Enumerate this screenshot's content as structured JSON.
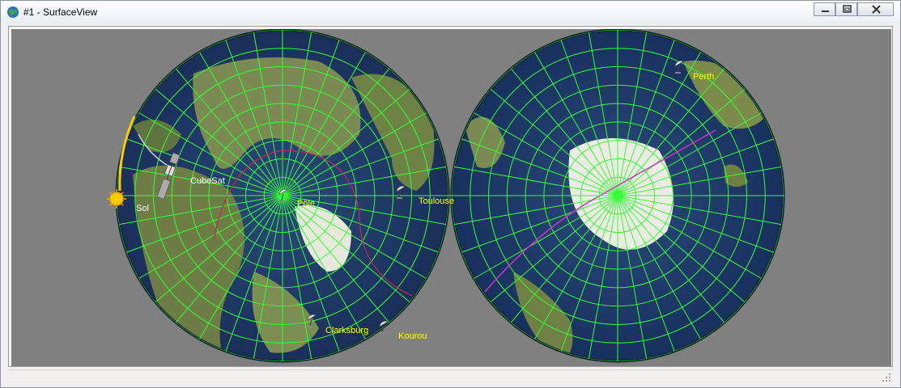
{
  "window": {
    "title": "#1 - SurfaceView",
    "controls": [
      "minimize",
      "restore",
      "close"
    ]
  },
  "map": {
    "background": "#808080",
    "grid_color": "#33ff33",
    "label_color": "#ffff00",
    "left_hemisphere": "north-polar",
    "right_hemisphere": "south-polar"
  },
  "markers": {
    "sun": {
      "label": "Sol",
      "icon": "sun-icon"
    },
    "cubesat": {
      "label": "CubeSat",
      "icon": "satellite-icon"
    },
    "stations": [
      {
        "label": "Pôle",
        "icon": "ground-station-icon"
      },
      {
        "label": "Toulouse",
        "icon": "ground-station-icon"
      },
      {
        "label": "Clarksburg",
        "icon": "ground-station-icon"
      },
      {
        "label": "Kourou",
        "icon": "ground-station-icon"
      },
      {
        "label": "Perth",
        "icon": "ground-station-icon"
      }
    ]
  }
}
